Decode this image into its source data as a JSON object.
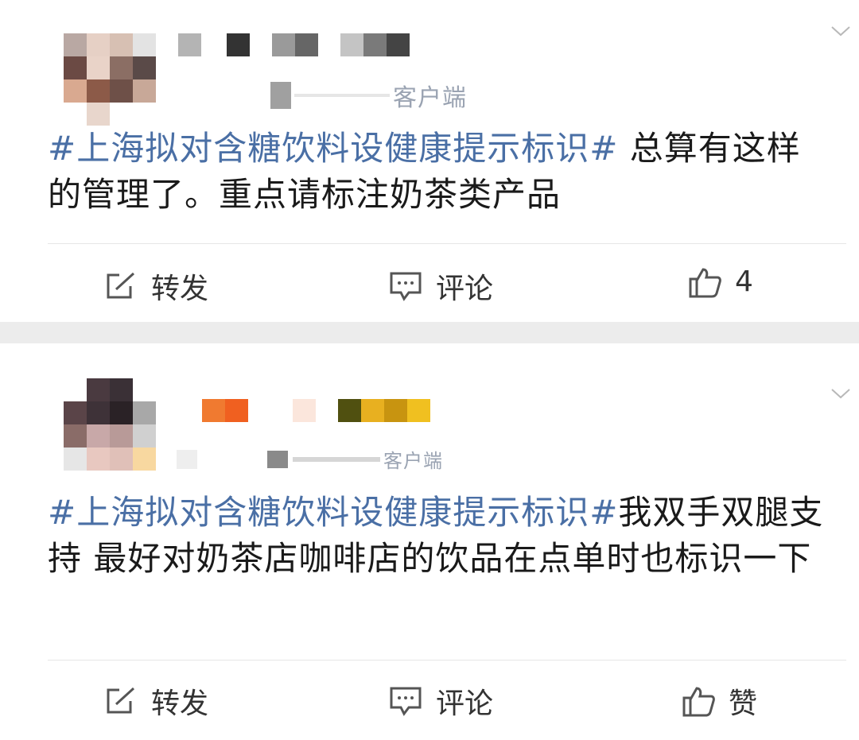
{
  "posts": [
    {
      "source": "客户端",
      "hashtag": "#上海拟对含糖饮料设健康提示标识#",
      "body": " 总算有这样的管理了。重点请标注奶茶类产品",
      "actions": {
        "repost": "转发",
        "comment": "评论",
        "like": "4"
      }
    },
    {
      "source": "客户端",
      "hashtag": "#上海拟对含糖饮料设健康提示标识#",
      "body": "我双手双腿支持 最好对奶茶店咖啡店的饮品在点单时也标识一下",
      "actions": {
        "repost": "转发",
        "comment": "评论",
        "like": "赞"
      }
    }
  ],
  "icons": {
    "repost": "edit-share-icon",
    "comment": "comment-bubble-icon",
    "like": "thumbs-up-icon",
    "menu": "chevron-down-icon"
  },
  "colors": {
    "hashtag": "#4a6fa5",
    "divider": "#e6e6e6",
    "gap": "#ececec"
  }
}
